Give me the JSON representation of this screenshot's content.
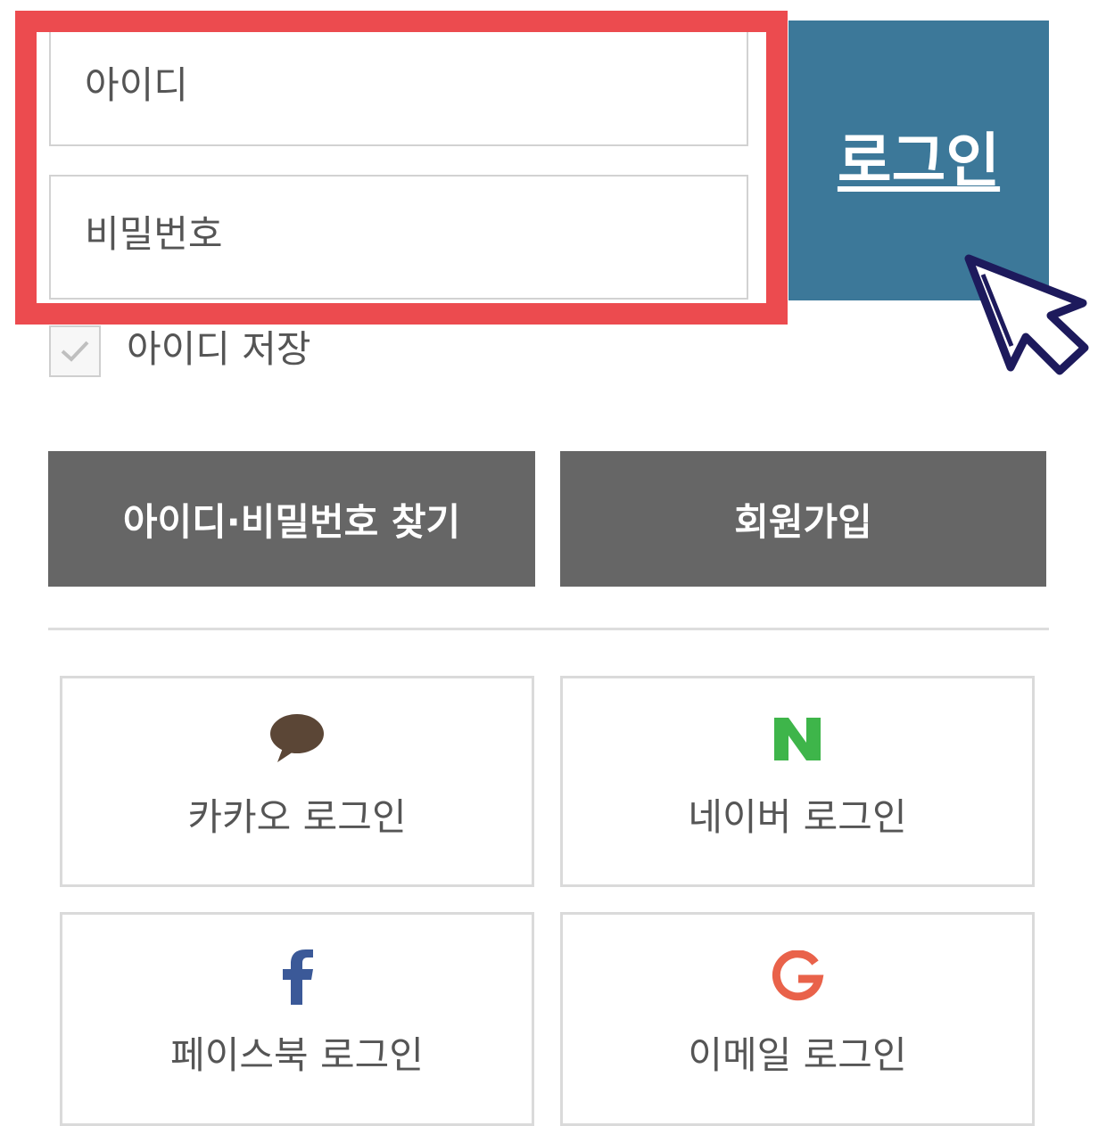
{
  "form": {
    "id_placeholder": "아이디",
    "password_placeholder": "비밀번호",
    "login_label": "로그인",
    "save_id_label": "아이디 저장"
  },
  "actions": {
    "find_label": "아이디·비밀번호 찾기",
    "join_label": "회원가입"
  },
  "social": {
    "kakao_label": "카카오 로그인",
    "naver_label": "네이버 로그인",
    "facebook_label": "페이스북 로그인",
    "email_label": "이메일 로그인"
  },
  "colors": {
    "highlight": "#ec4b4f",
    "login_button": "#3c7899",
    "gray_button": "#666666",
    "kakao_icon": "#5b4636",
    "naver_icon": "#3eb54a",
    "facebook_icon": "#3b5998",
    "google_icon": "#e9624a"
  },
  "icons": {
    "kakao": "speech-bubble-icon",
    "naver": "naver-n-icon",
    "facebook": "facebook-f-icon",
    "google": "google-g-icon",
    "check": "checkmark-icon",
    "cursor": "mouse-pointer-icon"
  }
}
